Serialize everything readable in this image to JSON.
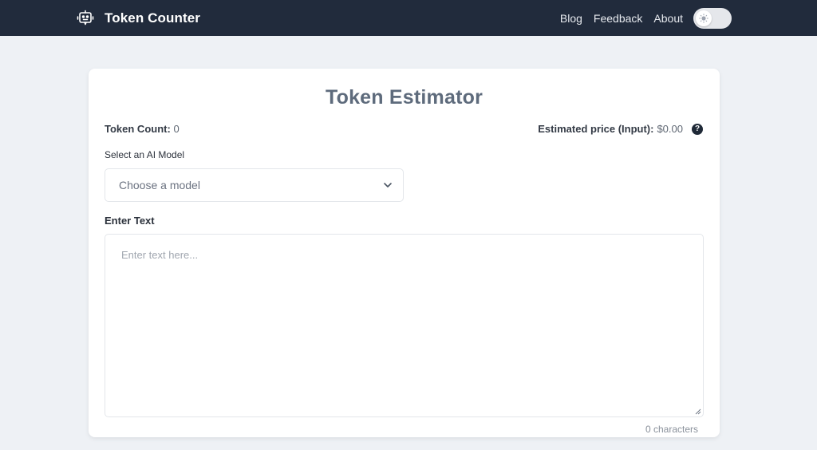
{
  "header": {
    "app_title": "Token Counter",
    "logo_icon": "robot-icon",
    "nav_links": [
      {
        "label": "Blog"
      },
      {
        "label": "Feedback"
      },
      {
        "label": "About"
      }
    ],
    "theme_toggle": {
      "icon": "sun-icon",
      "state": "light"
    }
  },
  "main": {
    "title": "Token Estimator",
    "token_count": {
      "label": "Token Count:",
      "value": "0"
    },
    "price": {
      "label": "Estimated price (Input):",
      "value": "$0.00",
      "help_icon": "question-icon"
    },
    "model_select": {
      "label": "Select an AI Model",
      "placeholder": "Choose a model"
    },
    "text_input": {
      "label": "Enter Text",
      "placeholder": "Enter text here...",
      "value": ""
    },
    "char_count": "0 characters"
  }
}
